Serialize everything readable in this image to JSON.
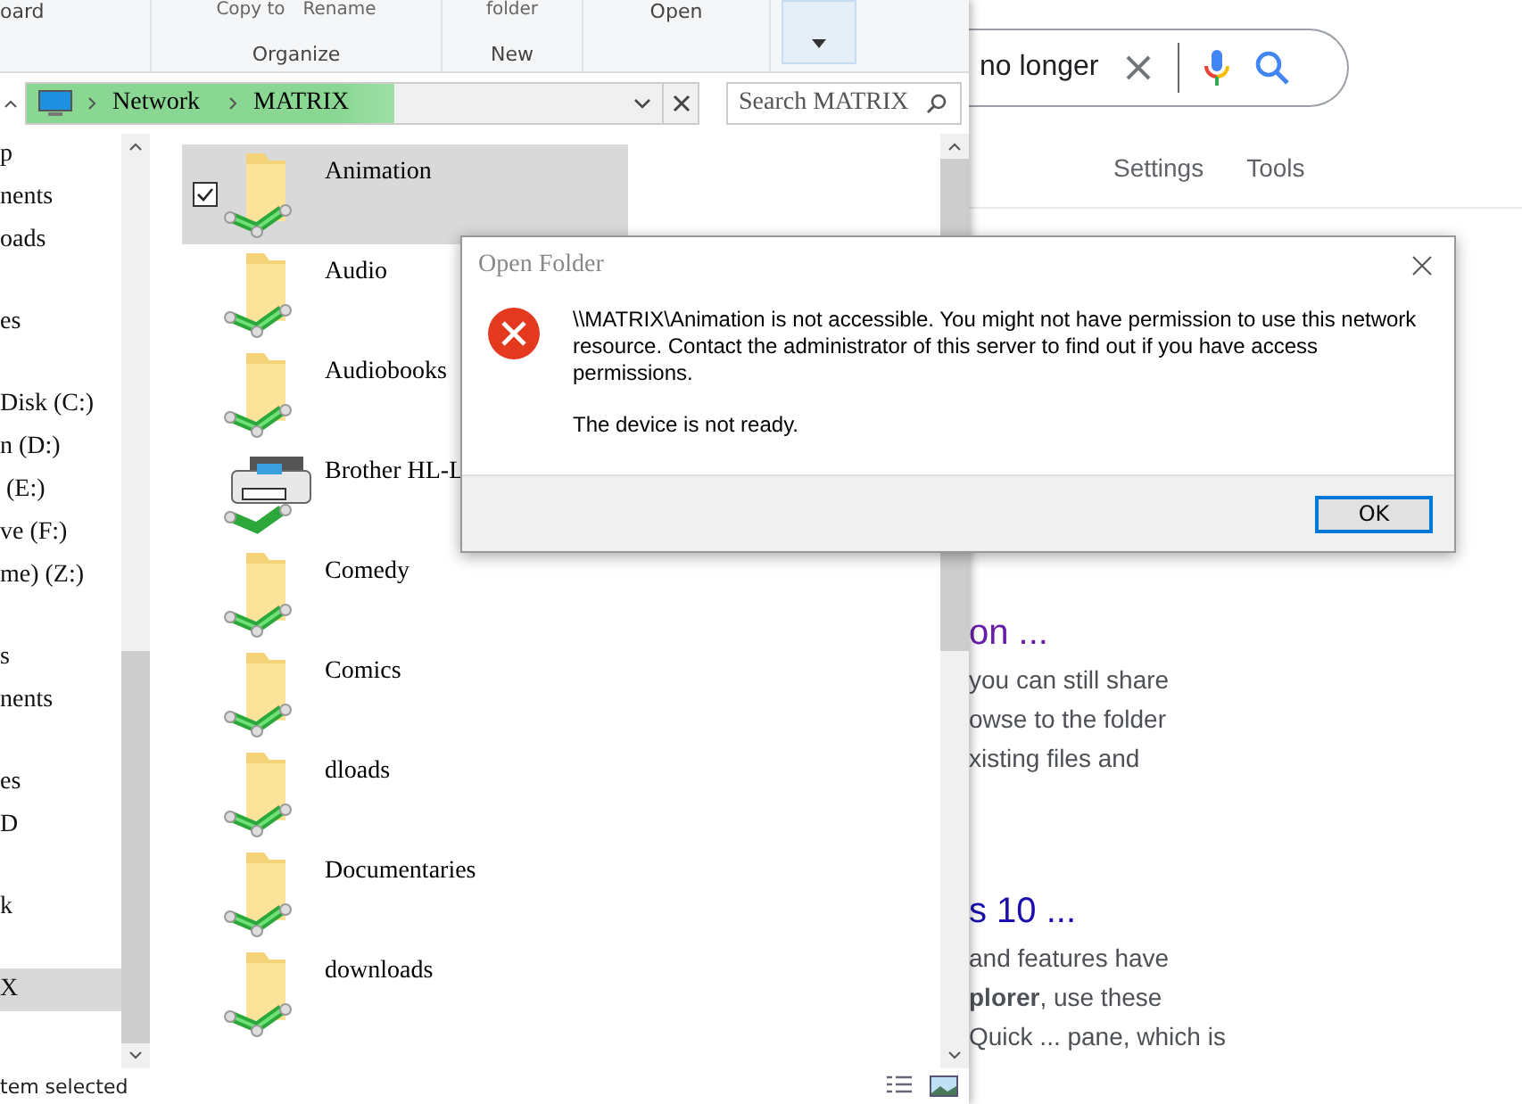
{
  "ribbon": {
    "groups": [
      {
        "label": "oard"
      },
      {
        "label": "Organize",
        "buttons": [
          "Copy to",
          "Rename"
        ]
      },
      {
        "label": "New",
        "buttons": [
          "folder"
        ]
      },
      {
        "label": "Open"
      }
    ]
  },
  "address_bar": {
    "level": 0.58,
    "crumbs": [
      "Network",
      "MATRIX"
    ]
  },
  "search": {
    "placeholder": "Search MATRIX"
  },
  "nav_pane": {
    "groups": [
      {
        "items": [
          {
            "label": "p",
            "selected": false
          },
          {
            "label": "nents",
            "selected": false
          },
          {
            "label": "oads",
            "selected": false
          }
        ]
      },
      {
        "items": [
          {
            "label": "es",
            "selected": false
          }
        ]
      },
      {
        "items": [
          {
            "label": "Disk (C:)",
            "selected": false
          },
          {
            "label": "n (D:)",
            "selected": false
          },
          {
            "label": " (E:)",
            "selected": false
          },
          {
            "label": "ve (F:)",
            "selected": false
          },
          {
            "label": "me) (Z:)",
            "selected": false
          }
        ]
      },
      {
        "items": [
          {
            "label": "s",
            "selected": false
          },
          {
            "label": "nents",
            "selected": false
          }
        ]
      },
      {
        "items": [
          {
            "label": "es",
            "selected": false
          },
          {
            "label": "D",
            "selected": false
          }
        ]
      },
      {
        "items": [
          {
            "label": "k",
            "selected": false
          }
        ]
      },
      {
        "items": [
          {
            "label": "X",
            "selected": true
          }
        ]
      }
    ]
  },
  "files": [
    {
      "name": "Animation",
      "kind": "folder",
      "selected": true,
      "checked": true
    },
    {
      "name": "Audio",
      "kind": "folder",
      "selected": false
    },
    {
      "name": "Audiobooks",
      "kind": "folder",
      "selected": false
    },
    {
      "name": "Brother HL-L",
      "kind": "printer",
      "selected": false
    },
    {
      "name": "Comedy",
      "kind": "folder",
      "selected": false
    },
    {
      "name": "Comics",
      "kind": "folder",
      "selected": false
    },
    {
      "name": "dloads",
      "kind": "folder",
      "selected": false
    },
    {
      "name": "Documentaries",
      "kind": "folder",
      "selected": false
    },
    {
      "name": "downloads",
      "kind": "folder",
      "selected": false
    }
  ],
  "status_bar": {
    "text": "tem selected"
  },
  "browser": {
    "query": "no longer",
    "tabs": [
      "Settings",
      "Tools"
    ],
    "results": [
      {
        "title": "on ...",
        "visited": true,
        "lines": [
          "you can still share",
          "owse to the folder",
          "xisting files and"
        ]
      },
      {
        "title": "s 10 ...",
        "visited": false,
        "lines": [
          "and features have",
          "**plorer**, use these",
          "Quick ... pane, which is"
        ]
      }
    ]
  },
  "dialog": {
    "title": "Open Folder",
    "message": "\\\\MATRIX\\Animation is not accessible. You might not have permission to use this network resource. Contact the administrator of this server to find out if you have access permissions.",
    "detail": "The device is not ready.",
    "buttons": [
      {
        "label": "OK",
        "default": true
      }
    ]
  }
}
